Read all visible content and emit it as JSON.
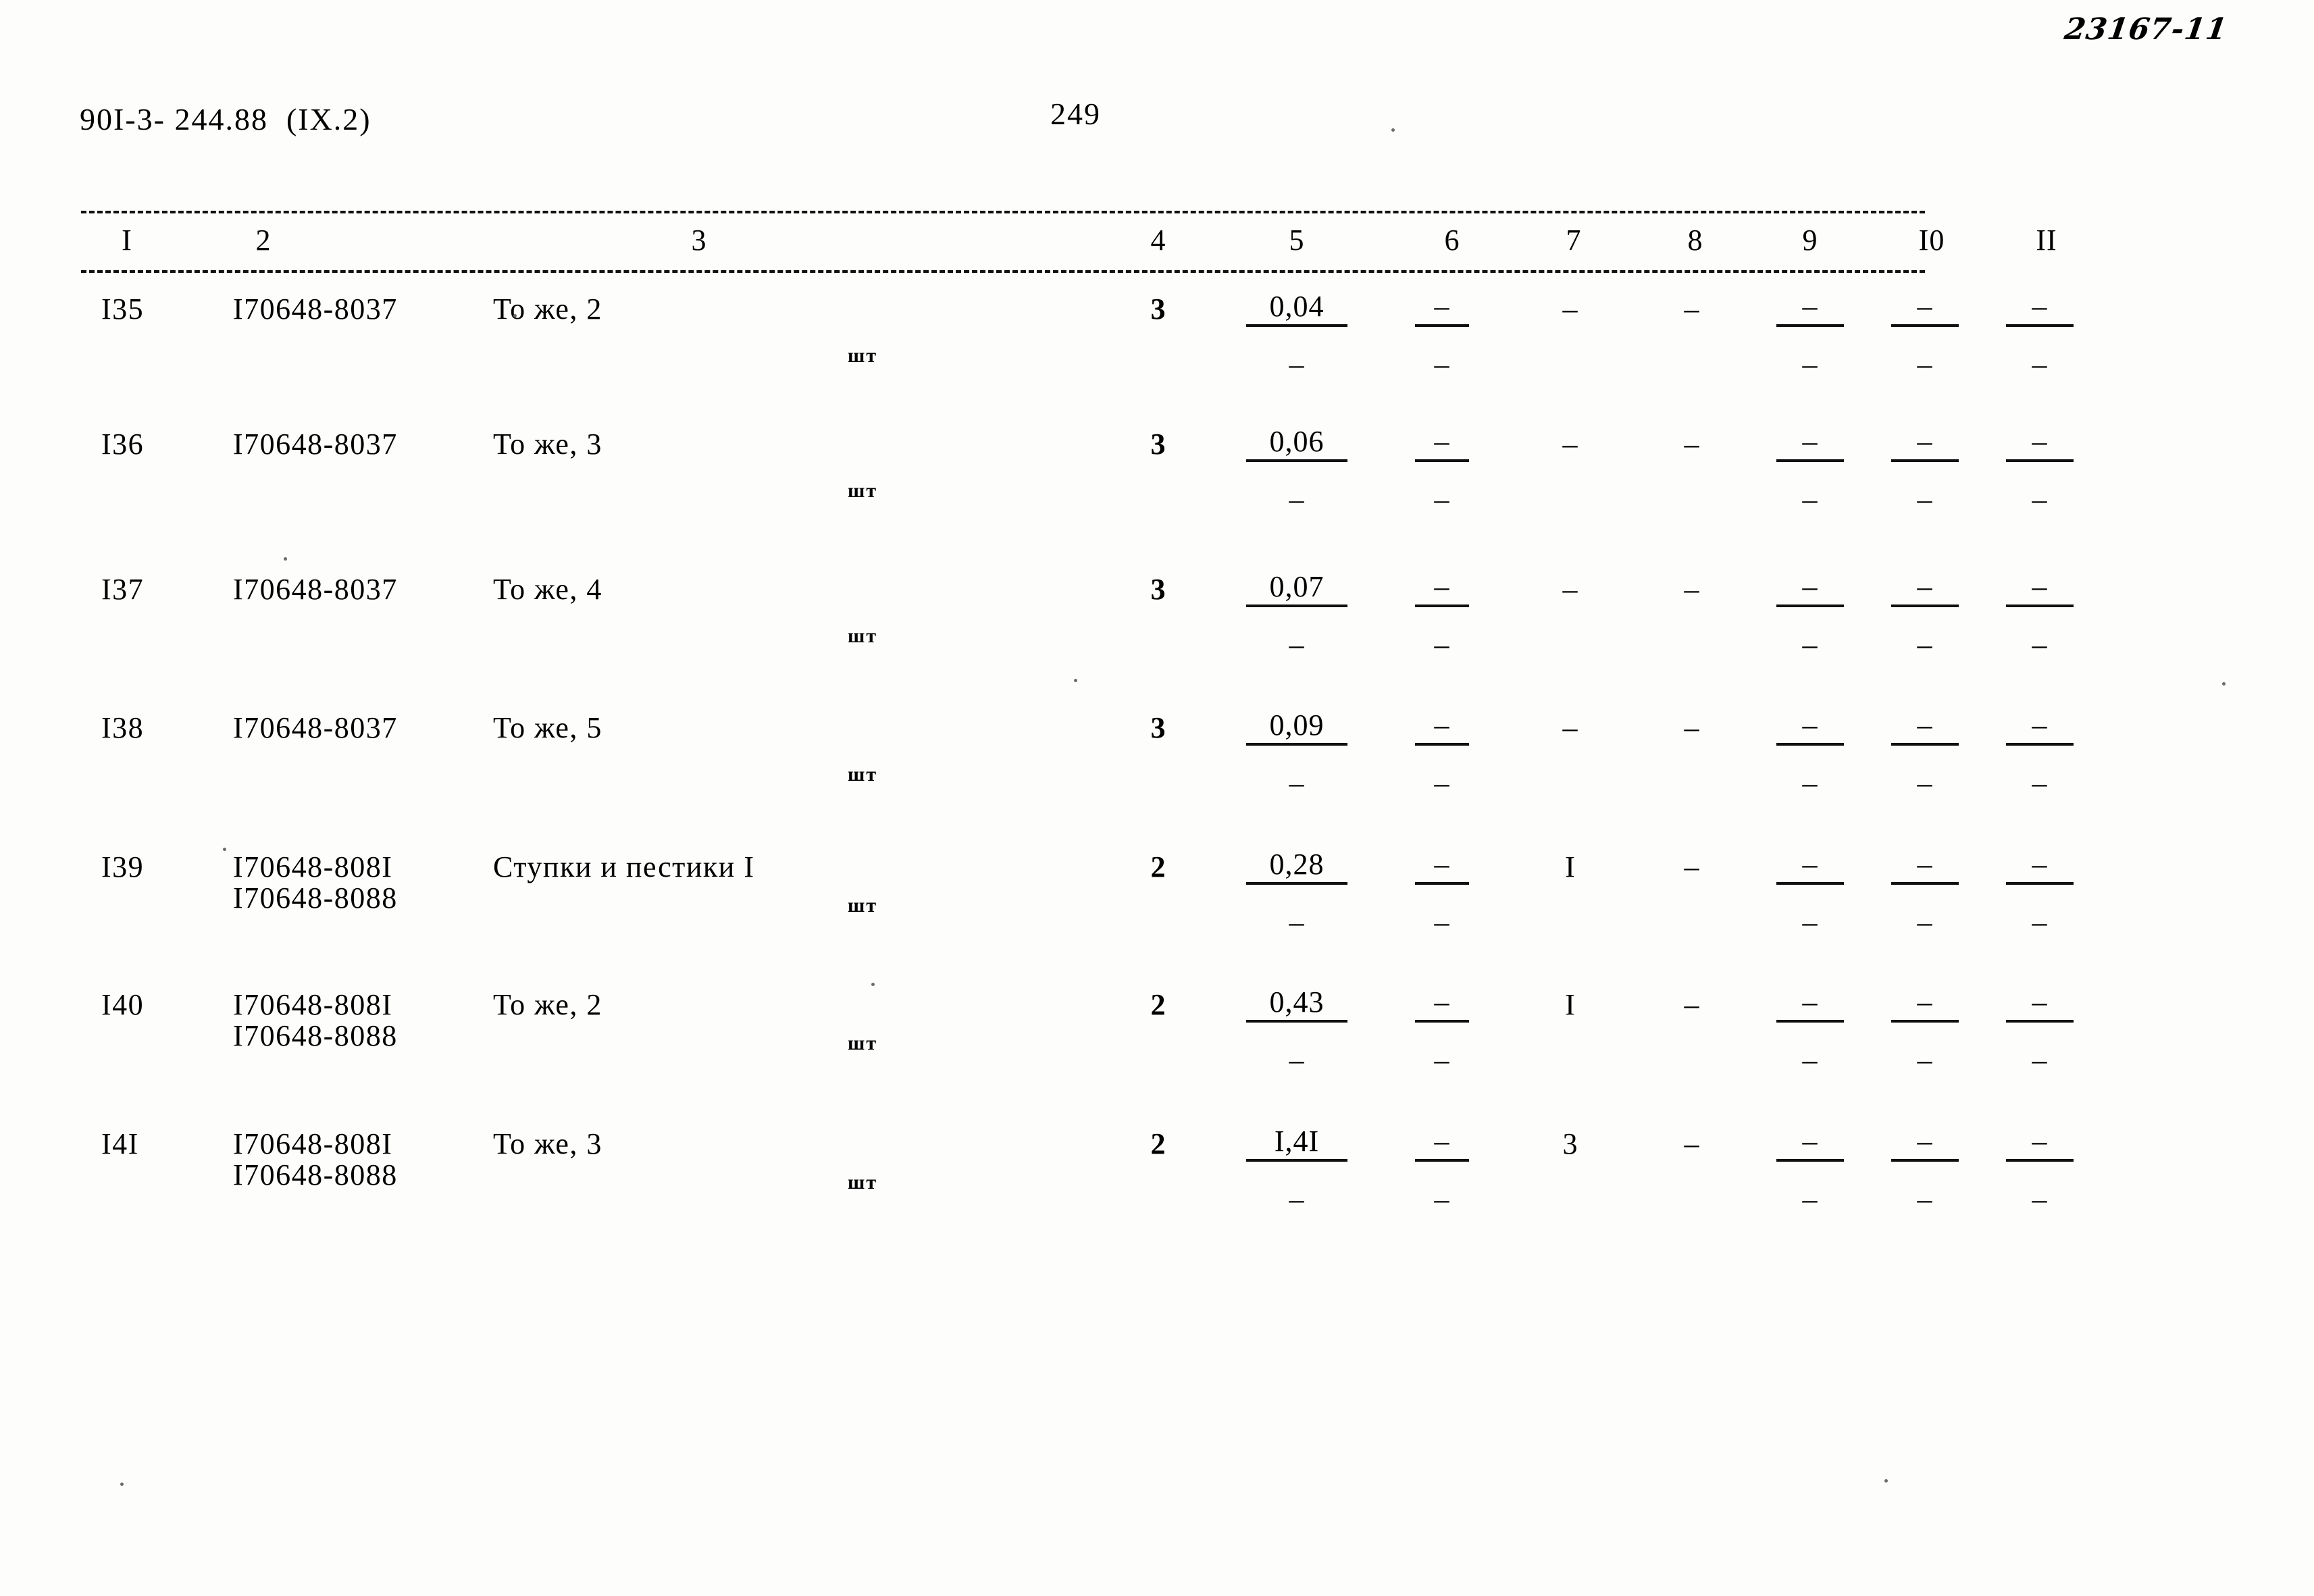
{
  "document": {
    "code": "90I-3- 244.88  (IX.2)",
    "page_number": "249",
    "archive_mark": "23167-11"
  },
  "table": {
    "column_headers": [
      "I",
      "2",
      "3",
      "4",
      "5",
      "6",
      "7",
      "8",
      "9",
      "I0",
      "II"
    ],
    "unit_label": "шт",
    "dash": "–",
    "rows": [
      {
        "no": "I35",
        "code1": "I70648-8037",
        "code2": "",
        "description": "То же, 2",
        "unit": "шт",
        "col4": "3",
        "col5_top": "0,04",
        "col5_bottom": "–",
        "col6_top": "–",
        "col6_bottom": "–",
        "col7": "–",
        "col8": "–",
        "col9_top": "–",
        "col9_bottom": "–",
        "col10_top": "–",
        "col10_bottom": "–",
        "col11_top": "–",
        "col11_bottom": "–"
      },
      {
        "no": "I36",
        "code1": "I70648-8037",
        "code2": "",
        "description": "То же, 3",
        "unit": "шт",
        "col4": "3",
        "col5_top": "0,06",
        "col5_bottom": "–",
        "col6_top": "–",
        "col6_bottom": "–",
        "col7": "–",
        "col8": "–",
        "col9_top": "–",
        "col9_bottom": "–",
        "col10_top": "–",
        "col10_bottom": "–",
        "col11_top": "–",
        "col11_bottom": "–"
      },
      {
        "no": "I37",
        "code1": "I70648-8037",
        "code2": "",
        "description": "То же, 4",
        "unit": "шт",
        "col4": "3",
        "col5_top": "0,07",
        "col5_bottom": "–",
        "col6_top": "–",
        "col6_bottom": "–",
        "col7": "–",
        "col8": "–",
        "col9_top": "–",
        "col9_bottom": "–",
        "col10_top": "–",
        "col10_bottom": "–",
        "col11_top": "–",
        "col11_bottom": "–"
      },
      {
        "no": "I38",
        "code1": "I70648-8037",
        "code2": "",
        "description": "То же, 5",
        "unit": "шт",
        "col4": "3",
        "col5_top": "0,09",
        "col5_bottom": "–",
        "col6_top": "–",
        "col6_bottom": "–",
        "col7": "–",
        "col8": "–",
        "col9_top": "–",
        "col9_bottom": "–",
        "col10_top": "–",
        "col10_bottom": "–",
        "col11_top": "–",
        "col11_bottom": "–"
      },
      {
        "no": "I39",
        "code1": "I70648-808I",
        "code2": "I70648-8088",
        "description": "Ступки и пестики I",
        "unit": "шт",
        "col4": "2",
        "col5_top": "0,28",
        "col5_bottom": "–",
        "col6_top": "–",
        "col6_bottom": "–",
        "col7": "I",
        "col8": "–",
        "col9_top": "–",
        "col9_bottom": "–",
        "col10_top": "–",
        "col10_bottom": "–",
        "col11_top": "–",
        "col11_bottom": "–"
      },
      {
        "no": "I40",
        "code1": "I70648-808I",
        "code2": "I70648-8088",
        "description": "То же, 2",
        "unit": "шт",
        "col4": "2",
        "col5_top": "0,43",
        "col5_bottom": "–",
        "col6_top": "–",
        "col6_bottom": "–",
        "col7": "I",
        "col8": "–",
        "col9_top": "–",
        "col9_bottom": "–",
        "col10_top": "–",
        "col10_bottom": "–",
        "col11_top": "–",
        "col11_bottom": "–"
      },
      {
        "no": "I4I",
        "code1": "I70648-808I",
        "code2": "I70648-8088",
        "description": "То же, 3",
        "unit": "шт",
        "col4": "2",
        "col5_top": "I,4I",
        "col5_bottom": "–",
        "col6_top": "–",
        "col6_bottom": "–",
        "col7": "3",
        "col8": "–",
        "col9_top": "–",
        "col9_bottom": "–",
        "col10_top": "–",
        "col10_bottom": "–",
        "col11_top": "–",
        "col11_bottom": "–"
      }
    ]
  }
}
